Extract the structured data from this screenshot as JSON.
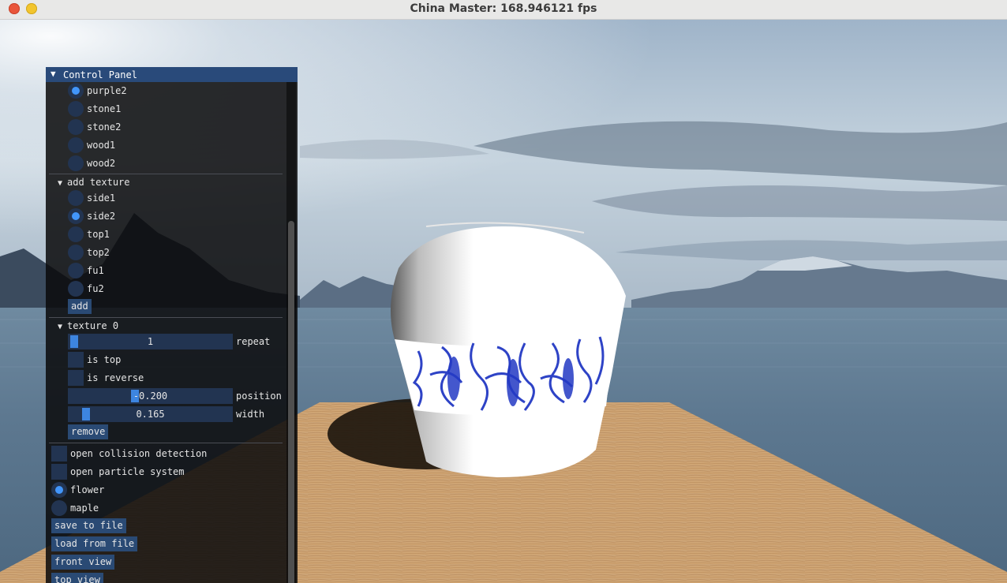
{
  "window": {
    "title": "China Master: 168.946121 fps"
  },
  "panel": {
    "title": "Control Panel",
    "materials": [
      {
        "label": "purple2",
        "selected": true
      },
      {
        "label": "stone1",
        "selected": false
      },
      {
        "label": "stone2",
        "selected": false
      },
      {
        "label": "wood1",
        "selected": false
      },
      {
        "label": "wood2",
        "selected": false
      }
    ],
    "add_texture": {
      "header": "add texture",
      "options": [
        {
          "label": "side1",
          "selected": false
        },
        {
          "label": "side2",
          "selected": true
        },
        {
          "label": "top1",
          "selected": false
        },
        {
          "label": "top2",
          "selected": false
        },
        {
          "label": "fu1",
          "selected": false
        },
        {
          "label": "fu2",
          "selected": false
        }
      ],
      "add_label": "add"
    },
    "texture0": {
      "header": "texture 0",
      "repeat": {
        "value": "1",
        "label": "repeat",
        "fraction": 0.0
      },
      "is_top": {
        "label": "is top",
        "checked": false
      },
      "is_reverse": {
        "label": "is reverse",
        "checked": false
      },
      "position": {
        "value": "-0.200",
        "label": "position",
        "fraction": 0.4
      },
      "width": {
        "value": "0.165",
        "label": "width",
        "fraction": 0.1
      },
      "remove_label": "remove"
    },
    "collision": {
      "label": "open collision detection",
      "checked": false
    },
    "particles": {
      "label": "open particle system",
      "checked": false
    },
    "particle_types": [
      {
        "label": "flower",
        "selected": true
      },
      {
        "label": "maple",
        "selected": false
      }
    ],
    "buttons": {
      "save": "save to file",
      "load": "load from file",
      "front": "front view",
      "top": "top view"
    }
  },
  "colors": {
    "panel_header": "#294a7a",
    "widget_bg": "#223451",
    "accent": "#4296fa",
    "button": "#2a4a74"
  }
}
